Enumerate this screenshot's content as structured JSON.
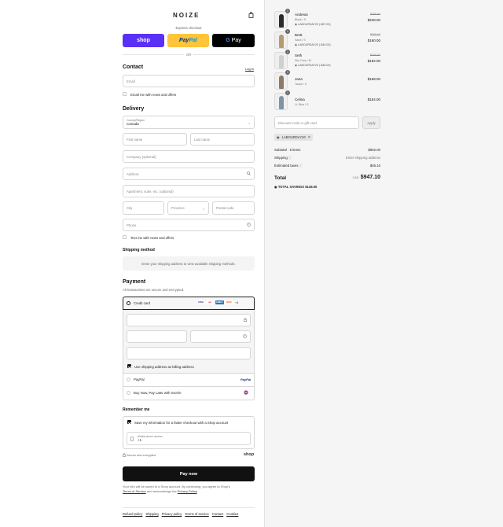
{
  "brand": {
    "logo": "NOIZE",
    "cart_icon": "shopping-bag-icon"
  },
  "express": {
    "label": "Express checkout",
    "shop": "shop",
    "paypal_pay": "Pay",
    "paypal_pal": "Pal",
    "gpay_g": "G",
    "gpay_pay": "Pay",
    "or": "OR"
  },
  "contact": {
    "title": "Contact",
    "login": "Log in",
    "email_placeholder": "Email",
    "news_label": "Email me with news and offers"
  },
  "delivery": {
    "title": "Delivery",
    "country_label": "Country/Region",
    "country_value": "Canada",
    "first_name": "First name",
    "last_name": "Last name",
    "company": "Company (optional)",
    "address": "Address",
    "apartment": "Apartment, suite, etc. (optional)",
    "city": "City",
    "province": "Province",
    "postal": "Postal code",
    "phone": "Phone",
    "sms_label": "Text me with news and offers"
  },
  "shipping": {
    "title": "Shipping method",
    "placeholder": "Enter your shipping address to view available shipping methods."
  },
  "payment": {
    "title": "Payment",
    "subtitle": "All transactions are secure and encrypted.",
    "credit_card": "Credit card",
    "more_cards": "+4",
    "cards": [
      {
        "name": "VISA",
        "color": "#1a1f71"
      },
      {
        "name": "MC",
        "color": "#eb001b"
      },
      {
        "name": "AMEX",
        "color": "#2e77bb"
      },
      {
        "name": "DISC",
        "color": "#ff6000"
      }
    ],
    "billing_label": "Use shipping address as billing address",
    "paypal": "PayPal",
    "paypal_logo": "PayPal",
    "sezzle": "Buy Now, Pay Later with Sezzle"
  },
  "remember": {
    "title": "Remember me",
    "save_label": "Save my information for a faster checkout with a Shop account",
    "phone_label": "Mobile phone number",
    "phone_value": "+1",
    "secure": "Secure and encrypted",
    "shop_logo": "shop"
  },
  "pay_button": "Pay now",
  "legal": {
    "text": "Your info will be saved to a Shop account. By continuing, you agree to Shop's",
    "terms": "Terms of Service",
    "and": "and acknowledge the",
    "privacy": "Privacy Policy",
    "end": "."
  },
  "footer_links": [
    "Refund policy",
    "Shipping",
    "Privacy policy",
    "Terms of service",
    "Contact",
    "Cookies"
  ],
  "cart": {
    "items": [
      {
        "qty": "1",
        "name": "Andreas",
        "variant": "Black / S",
        "code": "LABOURDAY20 (-$57.00)",
        "old": "$285.00",
        "price": "$228.00",
        "tone": "#2b2b2b"
      },
      {
        "qty": "1",
        "name": "Brett",
        "variant": "Sand / S",
        "code": "LABOURDAY20 (-$40.00)",
        "old": "$200.00",
        "price": "$160.00",
        "tone": "#b59a6e"
      },
      {
        "qty": "1",
        "name": "Seth",
        "variant": "Sky Grey / M",
        "code": "LABOURDAY20 (-$48.00)",
        "old": "$240.00",
        "price": "$192.00",
        "tone": "#cfcfcf"
      },
      {
        "qty": "1",
        "name": "Jana",
        "variant": "Taupe / S",
        "code": "",
        "old": "",
        "price": "$168.00",
        "tone": "#8c7a66"
      },
      {
        "qty": "1",
        "name": "Celina",
        "variant": "Lt. Blue / S",
        "code": "",
        "old": "",
        "price": "$154.00",
        "tone": "#7d93a8"
      }
    ],
    "discount_placeholder": "Discount code or gift card",
    "apply": "Apply",
    "applied_code": "LABOURDAY20",
    "subtotal_label": "Subtotal · 5 items",
    "subtotal_value": "$902.00",
    "shipping_label": "Shipping",
    "shipping_value": "Enter shipping address",
    "taxes_label": "Estimated taxes",
    "taxes_value": "$45.10",
    "total_label": "Total",
    "currency": "CAD",
    "total_value": "$947.10",
    "savings_label": "TOTAL SAVINGS",
    "savings_value": "$145.00"
  }
}
